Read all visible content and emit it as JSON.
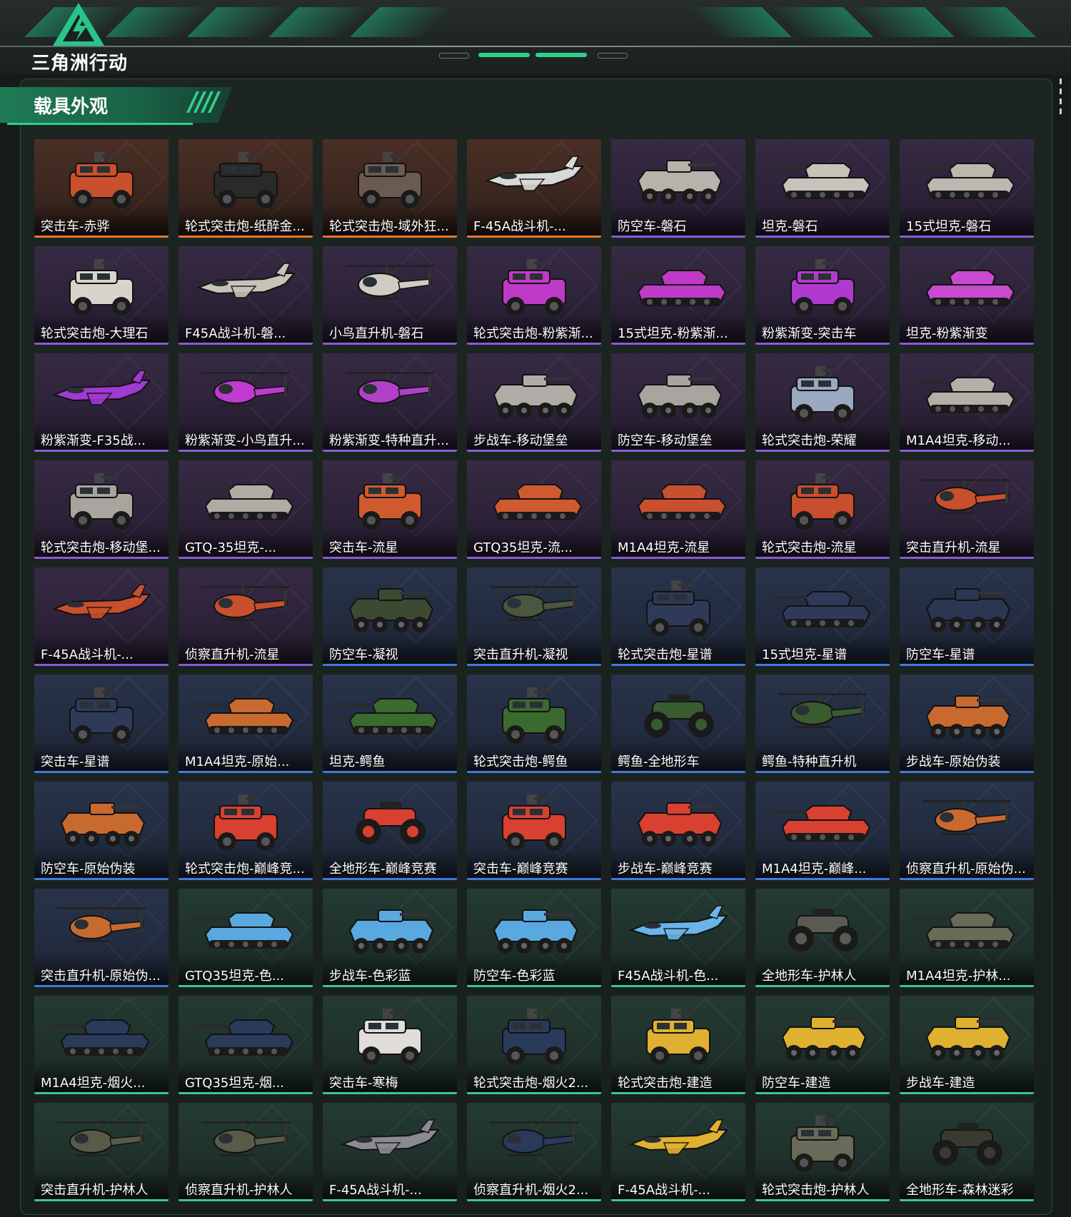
{
  "app": {
    "logo_text": "三角洲行动"
  },
  "section": {
    "title": "载具外观"
  },
  "colors": {
    "orange": "#e8782a",
    "purple": "#8a5ad8",
    "blue": "#3f7ae0",
    "green": "#38c98e",
    "accent": "#2bd28b"
  },
  "items": [
    {
      "label": "突击车-赤骅",
      "rarity": "orange",
      "vehicle": "armored-car",
      "tint": "#c8502c"
    },
    {
      "label": "轮式突击炮-纸醉金...",
      "rarity": "orange",
      "vehicle": "armored-car",
      "tint": "#2a2a2a"
    },
    {
      "label": "轮式突击炮-域外狂...",
      "rarity": "orange",
      "vehicle": "armored-car",
      "tint": "#6a5a50"
    },
    {
      "label": "F-45A战斗机-...",
      "rarity": "orange",
      "vehicle": "jet",
      "tint": "#d8d8d8"
    },
    {
      "label": "防空车-磐石",
      "rarity": "purple",
      "vehicle": "apc",
      "tint": "#b8b2aa"
    },
    {
      "label": "坦克-磐石",
      "rarity": "purple",
      "vehicle": "tank",
      "tint": "#c8c2ba"
    },
    {
      "label": "15式坦克-磐石",
      "rarity": "purple",
      "vehicle": "tank",
      "tint": "#bdb7b0"
    },
    {
      "label": "轮式突击炮-大理石",
      "rarity": "purple",
      "vehicle": "armored-car",
      "tint": "#d8d4cc"
    },
    {
      "label": "F45A战斗机-磐...",
      "rarity": "purple",
      "vehicle": "jet",
      "tint": "#c8c2b8"
    },
    {
      "label": "小鸟直升机-磐石",
      "rarity": "purple",
      "vehicle": "heli",
      "tint": "#d0ccc4"
    },
    {
      "label": "轮式突击炮-粉紫渐...",
      "rarity": "purple",
      "vehicle": "armored-car",
      "tint": "#c03ac8"
    },
    {
      "label": "15式坦克-粉紫渐...",
      "rarity": "purple",
      "vehicle": "tank",
      "tint": "#c03ac8"
    },
    {
      "label": "粉紫渐变-突击车",
      "rarity": "purple",
      "vehicle": "armored-car",
      "tint": "#b03ad0"
    },
    {
      "label": "坦克-粉紫渐变",
      "rarity": "purple",
      "vehicle": "tank",
      "tint": "#c84ad0"
    },
    {
      "label": "粉紫渐变-F35战...",
      "rarity": "purple",
      "vehicle": "jet",
      "tint": "#a03ad0"
    },
    {
      "label": "粉紫渐变-小鸟直升...",
      "rarity": "purple",
      "vehicle": "heli",
      "tint": "#c03ad0"
    },
    {
      "label": "粉紫渐变-特种直升...",
      "rarity": "purple",
      "vehicle": "heli",
      "tint": "#b040c8"
    },
    {
      "label": "步战车-移动堡垒",
      "rarity": "purple",
      "vehicle": "apc",
      "tint": "#b0aca6"
    },
    {
      "label": "防空车-移动堡垒",
      "rarity": "purple",
      "vehicle": "apc",
      "tint": "#a8a49e"
    },
    {
      "label": "轮式突击炮-荣耀",
      "rarity": "purple",
      "vehicle": "armored-car",
      "tint": "#9aa8c0"
    },
    {
      "label": "M1A4坦克-移动...",
      "rarity": "purple",
      "vehicle": "tank",
      "tint": "#b4b0a8"
    },
    {
      "label": "轮式突击炮-移动堡...",
      "rarity": "purple",
      "vehicle": "armored-car",
      "tint": "#a8a49e"
    },
    {
      "label": "GTQ-35坦克-...",
      "rarity": "purple",
      "vehicle": "tank",
      "tint": "#b0aca4"
    },
    {
      "label": "突击车-流星",
      "rarity": "purple",
      "vehicle": "armored-car",
      "tint": "#d05a30"
    },
    {
      "label": "GTQ35坦克-流...",
      "rarity": "purple",
      "vehicle": "tank",
      "tint": "#d05a30"
    },
    {
      "label": "M1A4坦克-流星",
      "rarity": "purple",
      "vehicle": "tank",
      "tint": "#c85030"
    },
    {
      "label": "轮式突击炮-流星",
      "rarity": "purple",
      "vehicle": "armored-car",
      "tint": "#c84e2e"
    },
    {
      "label": "突击直升机-流星",
      "rarity": "purple",
      "vehicle": "heli",
      "tint": "#c8502c"
    },
    {
      "label": "F-45A战斗机-...",
      "rarity": "purple",
      "vehicle": "jet",
      "tint": "#c8502c"
    },
    {
      "label": "侦察直升机-流星",
      "rarity": "purple",
      "vehicle": "heli",
      "tint": "#c8502c"
    },
    {
      "label": "防空车-凝视",
      "rarity": "blue",
      "vehicle": "apc",
      "tint": "#3c4a32"
    },
    {
      "label": "突击直升机-凝视",
      "rarity": "blue",
      "vehicle": "heli",
      "tint": "#4a5640"
    },
    {
      "label": "轮式突击炮-星谱",
      "rarity": "blue",
      "vehicle": "armored-car",
      "tint": "#2e3a58"
    },
    {
      "label": "15式坦克-星谱",
      "rarity": "blue",
      "vehicle": "tank",
      "tint": "#2e3a58"
    },
    {
      "label": "防空车-星谱",
      "rarity": "blue",
      "vehicle": "apc",
      "tint": "#2a3652"
    },
    {
      "label": "突击车-星谱",
      "rarity": "blue",
      "vehicle": "armored-car",
      "tint": "#2e3a58"
    },
    {
      "label": "M1A4坦克-原始...",
      "rarity": "blue",
      "vehicle": "tank",
      "tint": "#c86a30"
    },
    {
      "label": "坦克-鳄鱼",
      "rarity": "blue",
      "vehicle": "tank",
      "tint": "#3a6a30"
    },
    {
      "label": "轮式突击炮-鳄鱼",
      "rarity": "blue",
      "vehicle": "armored-car",
      "tint": "#3a6a30"
    },
    {
      "label": "鳄鱼-全地形车",
      "rarity": "blue",
      "vehicle": "atv",
      "tint": "#3a5a30"
    },
    {
      "label": "鳄鱼-特种直升机",
      "rarity": "blue",
      "vehicle": "heli",
      "tint": "#3a5a30"
    },
    {
      "label": "步战车-原始伪装",
      "rarity": "blue",
      "vehicle": "apc",
      "tint": "#c86a30"
    },
    {
      "label": "防空车-原始伪装",
      "rarity": "blue",
      "vehicle": "apc",
      "tint": "#c86a30"
    },
    {
      "label": "轮式突击炮-巅峰竞...",
      "rarity": "blue",
      "vehicle": "armored-car",
      "tint": "#d84030"
    },
    {
      "label": "全地形车-巅峰竞赛",
      "rarity": "blue",
      "vehicle": "atv",
      "tint": "#d84030"
    },
    {
      "label": "突击车-巅峰竞赛",
      "rarity": "blue",
      "vehicle": "armored-car",
      "tint": "#d84030"
    },
    {
      "label": "步战车-巅峰竞赛",
      "rarity": "blue",
      "vehicle": "apc",
      "tint": "#d84030"
    },
    {
      "label": "M1A4坦克-巅峰...",
      "rarity": "blue",
      "vehicle": "tank",
      "tint": "#d84030"
    },
    {
      "label": "侦察直升机-原始伪...",
      "rarity": "blue",
      "vehicle": "heli",
      "tint": "#c86a30"
    },
    {
      "label": "突击直升机-原始伪...",
      "rarity": "blue",
      "vehicle": "heli",
      "tint": "#c86a30"
    },
    {
      "label": "GTQ35坦克-色...",
      "rarity": "green",
      "vehicle": "tank",
      "tint": "#5aa8e0"
    },
    {
      "label": "步战车-色彩蓝",
      "rarity": "green",
      "vehicle": "apc",
      "tint": "#5aa8e0"
    },
    {
      "label": "防空车-色彩蓝",
      "rarity": "green",
      "vehicle": "apc",
      "tint": "#5aa8e0"
    },
    {
      "label": "F45A战斗机-色...",
      "rarity": "green",
      "vehicle": "jet",
      "tint": "#6ab4e8"
    },
    {
      "label": "全地形车-护林人",
      "rarity": "green",
      "vehicle": "atv",
      "tint": "#5a5a50"
    },
    {
      "label": "M1A4坦克-护林...",
      "rarity": "green",
      "vehicle": "tank",
      "tint": "#6a6a58"
    },
    {
      "label": "M1A4坦克-烟火...",
      "rarity": "green",
      "vehicle": "tank",
      "tint": "#2a3a5a"
    },
    {
      "label": "GTQ35坦克-烟...",
      "rarity": "green",
      "vehicle": "tank",
      "tint": "#2a3a5a"
    },
    {
      "label": "突击车-寒梅",
      "rarity": "green",
      "vehicle": "armored-car",
      "tint": "#e0dcd8"
    },
    {
      "label": "轮式突击炮-烟火2...",
      "rarity": "green",
      "vehicle": "armored-car",
      "tint": "#2a3a5a"
    },
    {
      "label": "轮式突击炮-建造",
      "rarity": "green",
      "vehicle": "armored-car",
      "tint": "#e0b030"
    },
    {
      "label": "防空车-建造",
      "rarity": "green",
      "vehicle": "apc",
      "tint": "#e0b030"
    },
    {
      "label": "步战车-建造",
      "rarity": "green",
      "vehicle": "apc",
      "tint": "#e0b030"
    },
    {
      "label": "突击直升机-护林人",
      "rarity": "green",
      "vehicle": "heli",
      "tint": "#5a5a4a"
    },
    {
      "label": "侦察直升机-护林人",
      "rarity": "green",
      "vehicle": "heli",
      "tint": "#5a5a4a"
    },
    {
      "label": "F-45A战斗机-...",
      "rarity": "green",
      "vehicle": "jet",
      "tint": "#8a8a90"
    },
    {
      "label": "侦察直升机-烟火2...",
      "rarity": "green",
      "vehicle": "heli",
      "tint": "#2a3a5a"
    },
    {
      "label": "F-45A战斗机-...",
      "rarity": "green",
      "vehicle": "jet",
      "tint": "#e0b030"
    },
    {
      "label": "轮式突击炮-护林人",
      "rarity": "green",
      "vehicle": "armored-car",
      "tint": "#6a6a58"
    },
    {
      "label": "全地形车-森林迷彩",
      "rarity": "green",
      "vehicle": "atv",
      "tint": "#3a3a30"
    }
  ]
}
